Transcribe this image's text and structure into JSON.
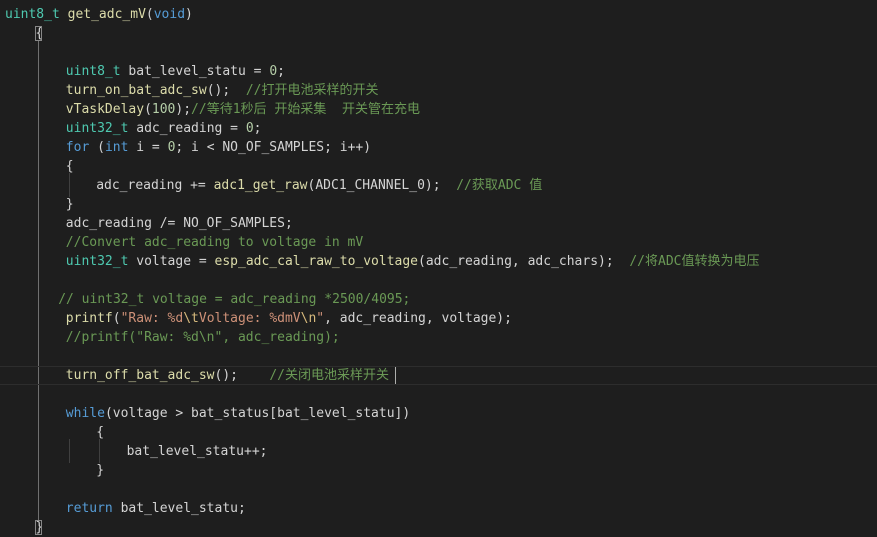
{
  "editor": {
    "language": "C",
    "theme": {
      "background": "#1e1e1e",
      "type": "#4ec9b0",
      "keyword": "#569cd6",
      "function": "#dcdcaa",
      "number": "#b5cea8",
      "comment": "#6a9955",
      "string": "#ce9178",
      "escape": "#d7ba7d",
      "plain": "#d4d4d4"
    },
    "lines": [
      {
        "indent": 0,
        "tokens": [
          [
            "t",
            "uint8_t"
          ],
          [
            "p",
            " "
          ],
          [
            "f",
            "get_adc_mV"
          ],
          [
            "p",
            "("
          ],
          [
            "k",
            "void"
          ],
          [
            "p",
            ")"
          ]
        ]
      },
      {
        "indent": 4,
        "tokens": [
          [
            "p",
            "{"
          ]
        ]
      },
      {
        "indent": 0,
        "tokens": []
      },
      {
        "indent": 8,
        "tokens": [
          [
            "t",
            "uint8_t"
          ],
          [
            "p",
            " bat_level_statu = "
          ],
          [
            "n",
            "0"
          ],
          [
            "p",
            ";"
          ]
        ]
      },
      {
        "indent": 8,
        "tokens": [
          [
            "f",
            "turn_on_bat_adc_sw"
          ],
          [
            "p",
            "();  "
          ],
          [
            "c",
            "//打开电池采样的开关"
          ]
        ]
      },
      {
        "indent": 8,
        "tokens": [
          [
            "f",
            "vTaskDelay"
          ],
          [
            "p",
            "("
          ],
          [
            "n",
            "100"
          ],
          [
            "p",
            ");"
          ],
          [
            "c",
            "//等待1秒后 开始采集  开关管在充电"
          ]
        ]
      },
      {
        "indent": 8,
        "tokens": [
          [
            "t",
            "uint32_t"
          ],
          [
            "p",
            " adc_reading = "
          ],
          [
            "n",
            "0"
          ],
          [
            "p",
            ";"
          ]
        ]
      },
      {
        "indent": 8,
        "tokens": [
          [
            "k",
            "for"
          ],
          [
            "p",
            " ("
          ],
          [
            "k",
            "int"
          ],
          [
            "p",
            " i = "
          ],
          [
            "n",
            "0"
          ],
          [
            "p",
            "; i < NO_OF_SAMPLES; i++)"
          ]
        ]
      },
      {
        "indent": 8,
        "tokens": [
          [
            "p",
            "{"
          ]
        ]
      },
      {
        "indent": 12,
        "tokens": [
          [
            "p",
            "adc_reading += "
          ],
          [
            "f",
            "adc1_get_raw"
          ],
          [
            "p",
            "(ADC1_CHANNEL_0);  "
          ],
          [
            "c",
            "//获取ADC 值"
          ]
        ]
      },
      {
        "indent": 8,
        "tokens": [
          [
            "p",
            "}"
          ]
        ]
      },
      {
        "indent": 8,
        "tokens": [
          [
            "p",
            "adc_reading /= NO_OF_SAMPLES;"
          ]
        ]
      },
      {
        "indent": 8,
        "tokens": [
          [
            "c",
            "//Convert adc_reading to voltage in mV"
          ]
        ]
      },
      {
        "indent": 8,
        "tokens": [
          [
            "t",
            "uint32_t"
          ],
          [
            "p",
            " voltage = "
          ],
          [
            "f",
            "esp_adc_cal_raw_to_voltage"
          ],
          [
            "p",
            "(adc_reading, adc_chars);  "
          ],
          [
            "c",
            "//将ADC值转换为电压"
          ]
        ]
      },
      {
        "indent": 0,
        "tokens": []
      },
      {
        "indent": 7,
        "tokens": [
          [
            "c",
            "// uint32_t voltage = adc_reading *2500/4095;"
          ]
        ]
      },
      {
        "indent": 8,
        "tokens": [
          [
            "f",
            "printf"
          ],
          [
            "p",
            "("
          ],
          [
            "s",
            "\"Raw: %d"
          ],
          [
            "e",
            "\\t"
          ],
          [
            "s",
            "Voltage: %dmV"
          ],
          [
            "e",
            "\\n"
          ],
          [
            "s",
            "\""
          ],
          [
            "p",
            ", adc_reading, voltage);"
          ]
        ]
      },
      {
        "indent": 8,
        "tokens": [
          [
            "c",
            "//printf(\"Raw: %d\\n\", adc_reading);"
          ]
        ]
      },
      {
        "indent": 0,
        "tokens": []
      },
      {
        "indent": 8,
        "tokens": [
          [
            "f",
            "turn_off_bat_adc_sw"
          ],
          [
            "p",
            "();    "
          ],
          [
            "c",
            "//关闭电池采样开关"
          ]
        ]
      },
      {
        "indent": 0,
        "tokens": []
      },
      {
        "indent": 8,
        "tokens": [
          [
            "k",
            "while"
          ],
          [
            "p",
            "(voltage > bat_status[bat_level_statu])"
          ]
        ]
      },
      {
        "indent": 12,
        "tokens": [
          [
            "p",
            "{"
          ]
        ]
      },
      {
        "indent": 16,
        "tokens": [
          [
            "p",
            "bat_level_statu++;"
          ]
        ]
      },
      {
        "indent": 12,
        "tokens": [
          [
            "p",
            "}"
          ]
        ]
      },
      {
        "indent": 0,
        "tokens": []
      },
      {
        "indent": 8,
        "tokens": [
          [
            "k",
            "return"
          ],
          [
            "p",
            " bat_level_statu;"
          ]
        ]
      },
      {
        "indent": 4,
        "tokens": [
          [
            "p",
            "}"
          ]
        ]
      }
    ]
  }
}
